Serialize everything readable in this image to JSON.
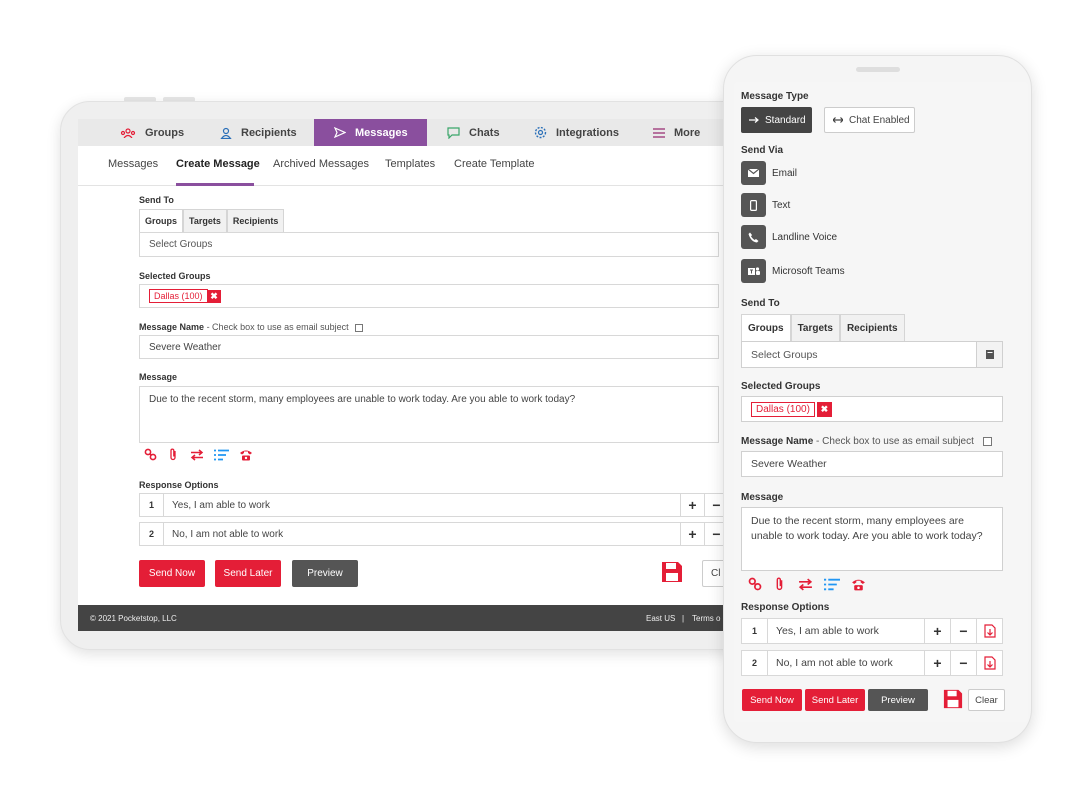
{
  "tablet": {
    "topnav": [
      {
        "label": "Groups",
        "icon": "groups-icon"
      },
      {
        "label": "Recipients",
        "icon": "user-icon"
      },
      {
        "label": "Messages",
        "icon": "send-icon",
        "active": true
      },
      {
        "label": "Chats",
        "icon": "chat-icon"
      },
      {
        "label": "Integrations",
        "icon": "gear-icon"
      },
      {
        "label": "More",
        "icon": "menu-icon"
      }
    ],
    "subnav": [
      {
        "label": "Messages"
      },
      {
        "label": "Create Message",
        "active": true
      },
      {
        "label": "Archived Messages"
      },
      {
        "label": "Templates"
      },
      {
        "label": "Create Template"
      }
    ],
    "send_to_label": "Send To",
    "tabs": [
      "Groups",
      "Targets",
      "Recipients"
    ],
    "select_placeholder": "Select Groups",
    "selected_groups_label": "Selected Groups",
    "chip": "Dallas (100)",
    "message_name_label": "Message Name",
    "message_name_hint": "- Check box to use as email subject",
    "message_name_value": "Severe Weather",
    "message_label": "Message",
    "message_value": "Due to the recent storm, many employees are unable to work today. Are you able to work today?",
    "response_label": "Response Options",
    "options": [
      {
        "num": "1",
        "text": "Yes, I am able to work"
      },
      {
        "num": "2",
        "text": "No, I am not able to work"
      }
    ],
    "send_now": "Send Now",
    "send_later": "Send Later",
    "preview": "Preview",
    "clear_partial": "Cl",
    "footer_left": "© 2021 Pocketstop, LLC",
    "footer_region": "East US",
    "footer_sep": "|",
    "footer_terms": "Terms o"
  },
  "phone": {
    "message_type_label": "Message Type",
    "type_standard": "Standard",
    "type_chat": "Chat Enabled",
    "send_via_label": "Send Via",
    "via": [
      {
        "label": "Email",
        "icon": "email-icon"
      },
      {
        "label": "Text",
        "icon": "mobile-icon"
      },
      {
        "label": "Landline Voice",
        "icon": "phone-icon"
      },
      {
        "label": "Microsoft Teams",
        "icon": "teams-icon"
      }
    ],
    "send_to_label": "Send To",
    "tabs": [
      "Groups",
      "Targets",
      "Recipients"
    ],
    "select_placeholder": "Select Groups",
    "selected_groups_label": "Selected Groups",
    "chip": "Dallas (100)",
    "message_name_label": "Message Name",
    "message_name_hint": "- Check box to use as email subject",
    "message_name_value": "Severe Weather",
    "message_label": "Message",
    "message_value": "Due to the recent storm, many employees are unable to work today. Are you able to work today?",
    "response_label": "Response Options",
    "options": [
      {
        "num": "1",
        "text": "Yes, I am able to work"
      },
      {
        "num": "2",
        "text": "No, I am not able to work"
      }
    ],
    "send_now": "Send Now",
    "send_later": "Send Later",
    "preview": "Preview",
    "clear": "Clear"
  },
  "colors": {
    "accent": "#8a4f9e",
    "red": "#e41e37",
    "dark": "#555555",
    "link_blue": "#2196f3"
  }
}
